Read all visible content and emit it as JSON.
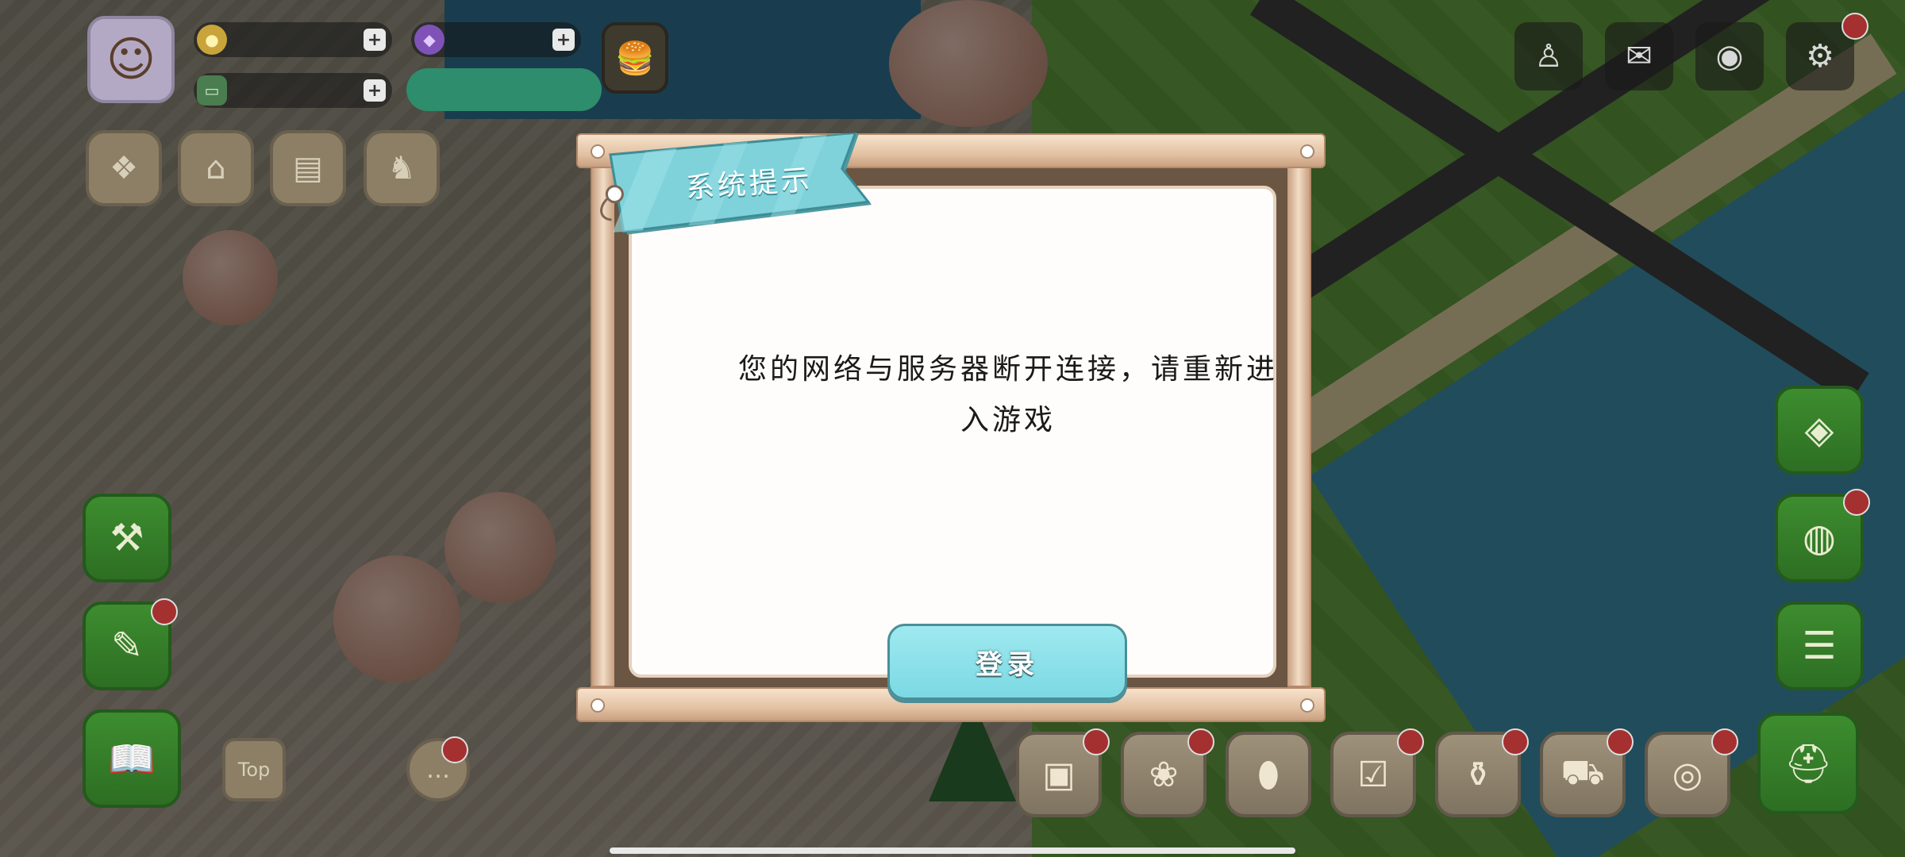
{
  "hud": {
    "gold_value": "",
    "gem_value": "",
    "energy_value": "",
    "event_button": "",
    "gold_icon": "coin-icon",
    "gem_icon": "gem-icon",
    "plus_symbol": "+"
  },
  "dialog": {
    "title": "系统提示",
    "message": "您的网络与服务器断开连接，请重新进入游戏",
    "login_button": "登录"
  },
  "bottom_bar_icons": [
    "camera-box-icon",
    "plant-icon",
    "balloon-icon",
    "checklist-icon",
    "bottle-icon",
    "car-icon",
    "plate-icon",
    "hardhat-icon"
  ],
  "top_right_icons": [
    "character-icon",
    "mail-icon",
    "camera-icon",
    "gear-icon"
  ],
  "colors": {
    "dialog_banner": "#7fd2da",
    "login_button": "#8fe3ea",
    "paper": "#fffdfb",
    "frame_wood": "#e8cbb0",
    "notification_badge": "#a53030"
  }
}
